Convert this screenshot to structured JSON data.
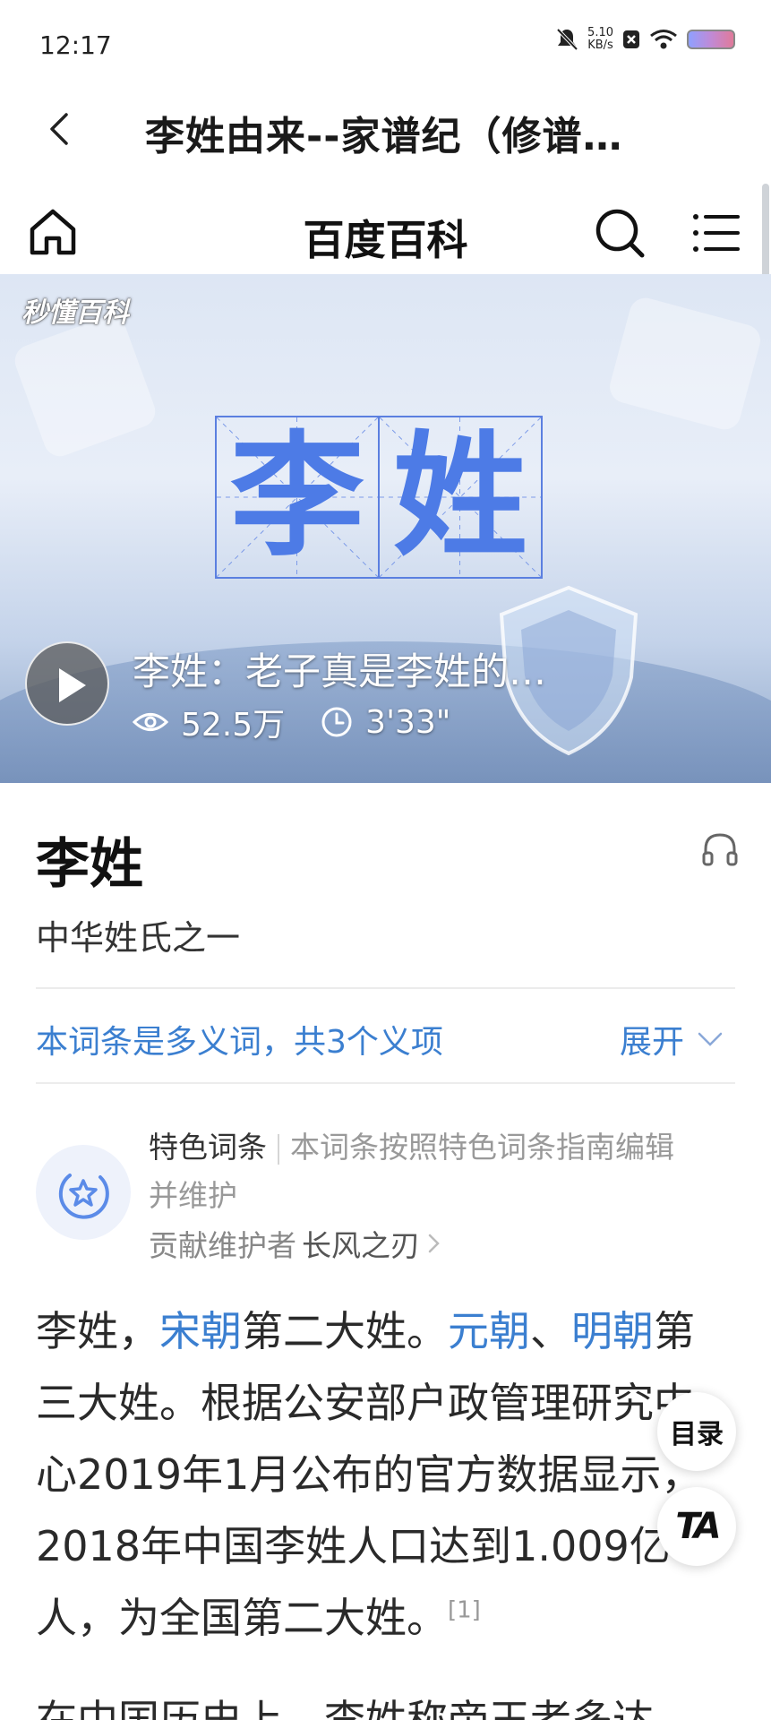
{
  "status_bar": {
    "time": "12:17",
    "net_speed": "5.10",
    "net_unit": "KB/s"
  },
  "title_bar": {
    "title": "李姓由来--家谱纪（修谱…"
  },
  "baike_header": {
    "title": "百度百科"
  },
  "video": {
    "logo": "秒懂百科",
    "chars": [
      "李",
      "姓"
    ],
    "title": "李姓：老子真是李姓的…",
    "views": "52.5万",
    "duration": "3'33\""
  },
  "entry": {
    "title": "李姓",
    "subtitle": "中华姓氏之一",
    "polysemy_note": "本词条是多义词，共3个义项",
    "expand_label": "展开"
  },
  "featured": {
    "label": "特色词条",
    "description_line1": "本词条按照特色词条指南编辑",
    "description_line2": "并维护",
    "contributor_prefix": "贡献维护者",
    "contributor_name": "长风之刃"
  },
  "article": {
    "p1": {
      "s1": "李姓，",
      "link1": "宋朝",
      "s2": "第二大姓。",
      "link2": "元朝",
      "s3": "、",
      "link3": "明朝",
      "s4": "第三大姓。根据公安部户政管理研究中心2019年1月公布的官方数据显示，2018年中国李姓人口达到1.009亿人，为全国第二大姓。",
      "ref": "[1]"
    },
    "p2": "在中国历史上，李姓称帝王者多达"
  },
  "floating": {
    "toc_label": "目录",
    "font_label": "TA"
  },
  "colors": {
    "link": "#3b7fd0",
    "accent_char": "#4d7be6"
  }
}
